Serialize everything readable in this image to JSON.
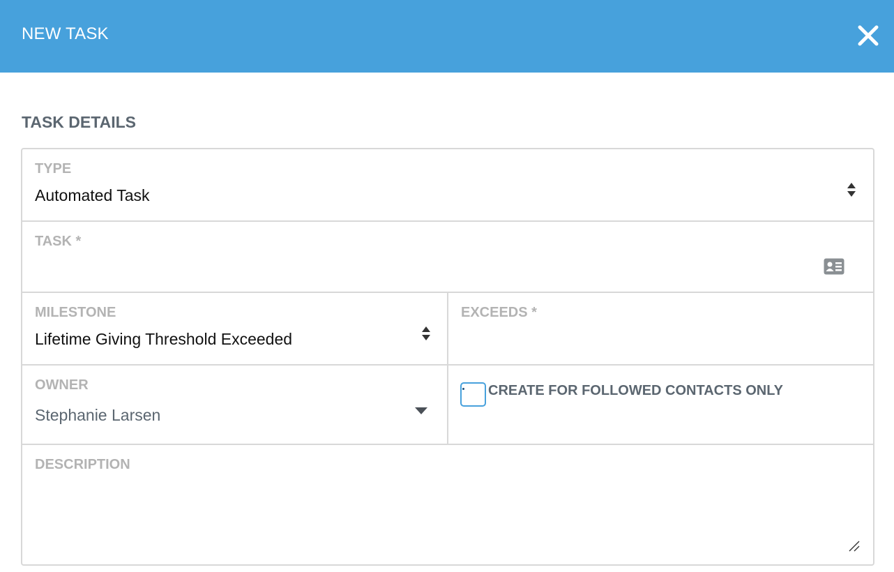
{
  "dialog": {
    "title": "NEW TASK",
    "close_icon": "close-icon"
  },
  "section": {
    "title": "TASK DETAILS"
  },
  "form": {
    "type": {
      "label": "TYPE",
      "value": "Automated Task",
      "icon": "sort-updown-icon"
    },
    "task": {
      "label": "TASK *",
      "value": "",
      "icon": "contact-card-icon"
    },
    "milestone": {
      "label": "MILESTONE",
      "value": "Lifetime Giving Threshold Exceeded",
      "icon": "sort-updown-icon"
    },
    "exceeds": {
      "label": "EXCEEDS *",
      "value": ""
    },
    "owner": {
      "label": "OWNER",
      "value": "Stephanie Larsen",
      "icon": "caret-down-icon"
    },
    "followed_only": {
      "label": "CREATE FOR FOLLOWED CONTACTS ONLY",
      "checked": false
    },
    "description": {
      "label": "DESCRIPTION",
      "value": ""
    }
  },
  "colors": {
    "header": "#47a1dc",
    "label": "#b3b3b3",
    "border": "#d8d8d8",
    "accent": "#47a1dc"
  }
}
